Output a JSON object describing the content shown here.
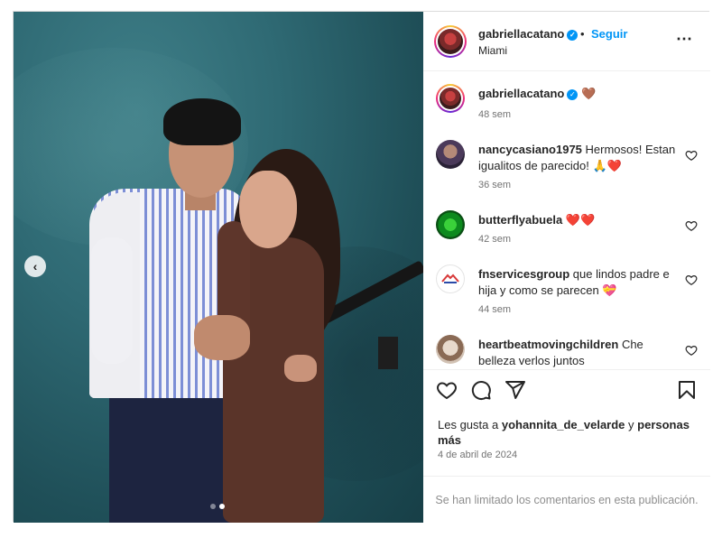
{
  "header": {
    "username": "gabriellacatano",
    "follow_label": "Seguir",
    "location": "Miami"
  },
  "caption": {
    "username": "gabriellacatano",
    "emoji": "🤎",
    "time": "48 sem"
  },
  "comments": [
    {
      "username": "nancycasiano1975",
      "text": "Hermosos! Estan igualitos de parecido! 🙏❤️",
      "time": "36 sem",
      "avatar": "nancy"
    },
    {
      "username": "butterflyabuela",
      "text": "❤️❤️",
      "time": "42 sem",
      "avatar": "butterfly"
    },
    {
      "username": "fnservicesgroup",
      "text": "que lindos padre e hija y como se parecen 💝",
      "time": "44 sem",
      "avatar": "fn"
    },
    {
      "username": "heartbeatmovingchildren",
      "text": "Che belleza verlos juntos",
      "time": "",
      "avatar": "heart"
    }
  ],
  "likes": {
    "prefix": "Les gusta a",
    "user": "yohannita_de_velarde",
    "joiner": "y",
    "others": "personas más"
  },
  "date": "4 de abril de 2024",
  "comments_limited": "Se han limitado los comentarios en esta publicación.",
  "icons": {
    "like": "heart-outline-icon",
    "comment": "comment-bubble-icon",
    "share": "paper-plane-icon",
    "save": "bookmark-icon",
    "more": "more-horizontal-icon",
    "prev": "chevron-left-icon",
    "verified": "verified-badge-icon"
  },
  "colors": {
    "verified": "#0095f6",
    "follow": "#0095f6",
    "muted": "#737373",
    "heart_emoji": "#8b5a3c"
  },
  "carousel": {
    "slides": 2,
    "active_index": 1
  }
}
